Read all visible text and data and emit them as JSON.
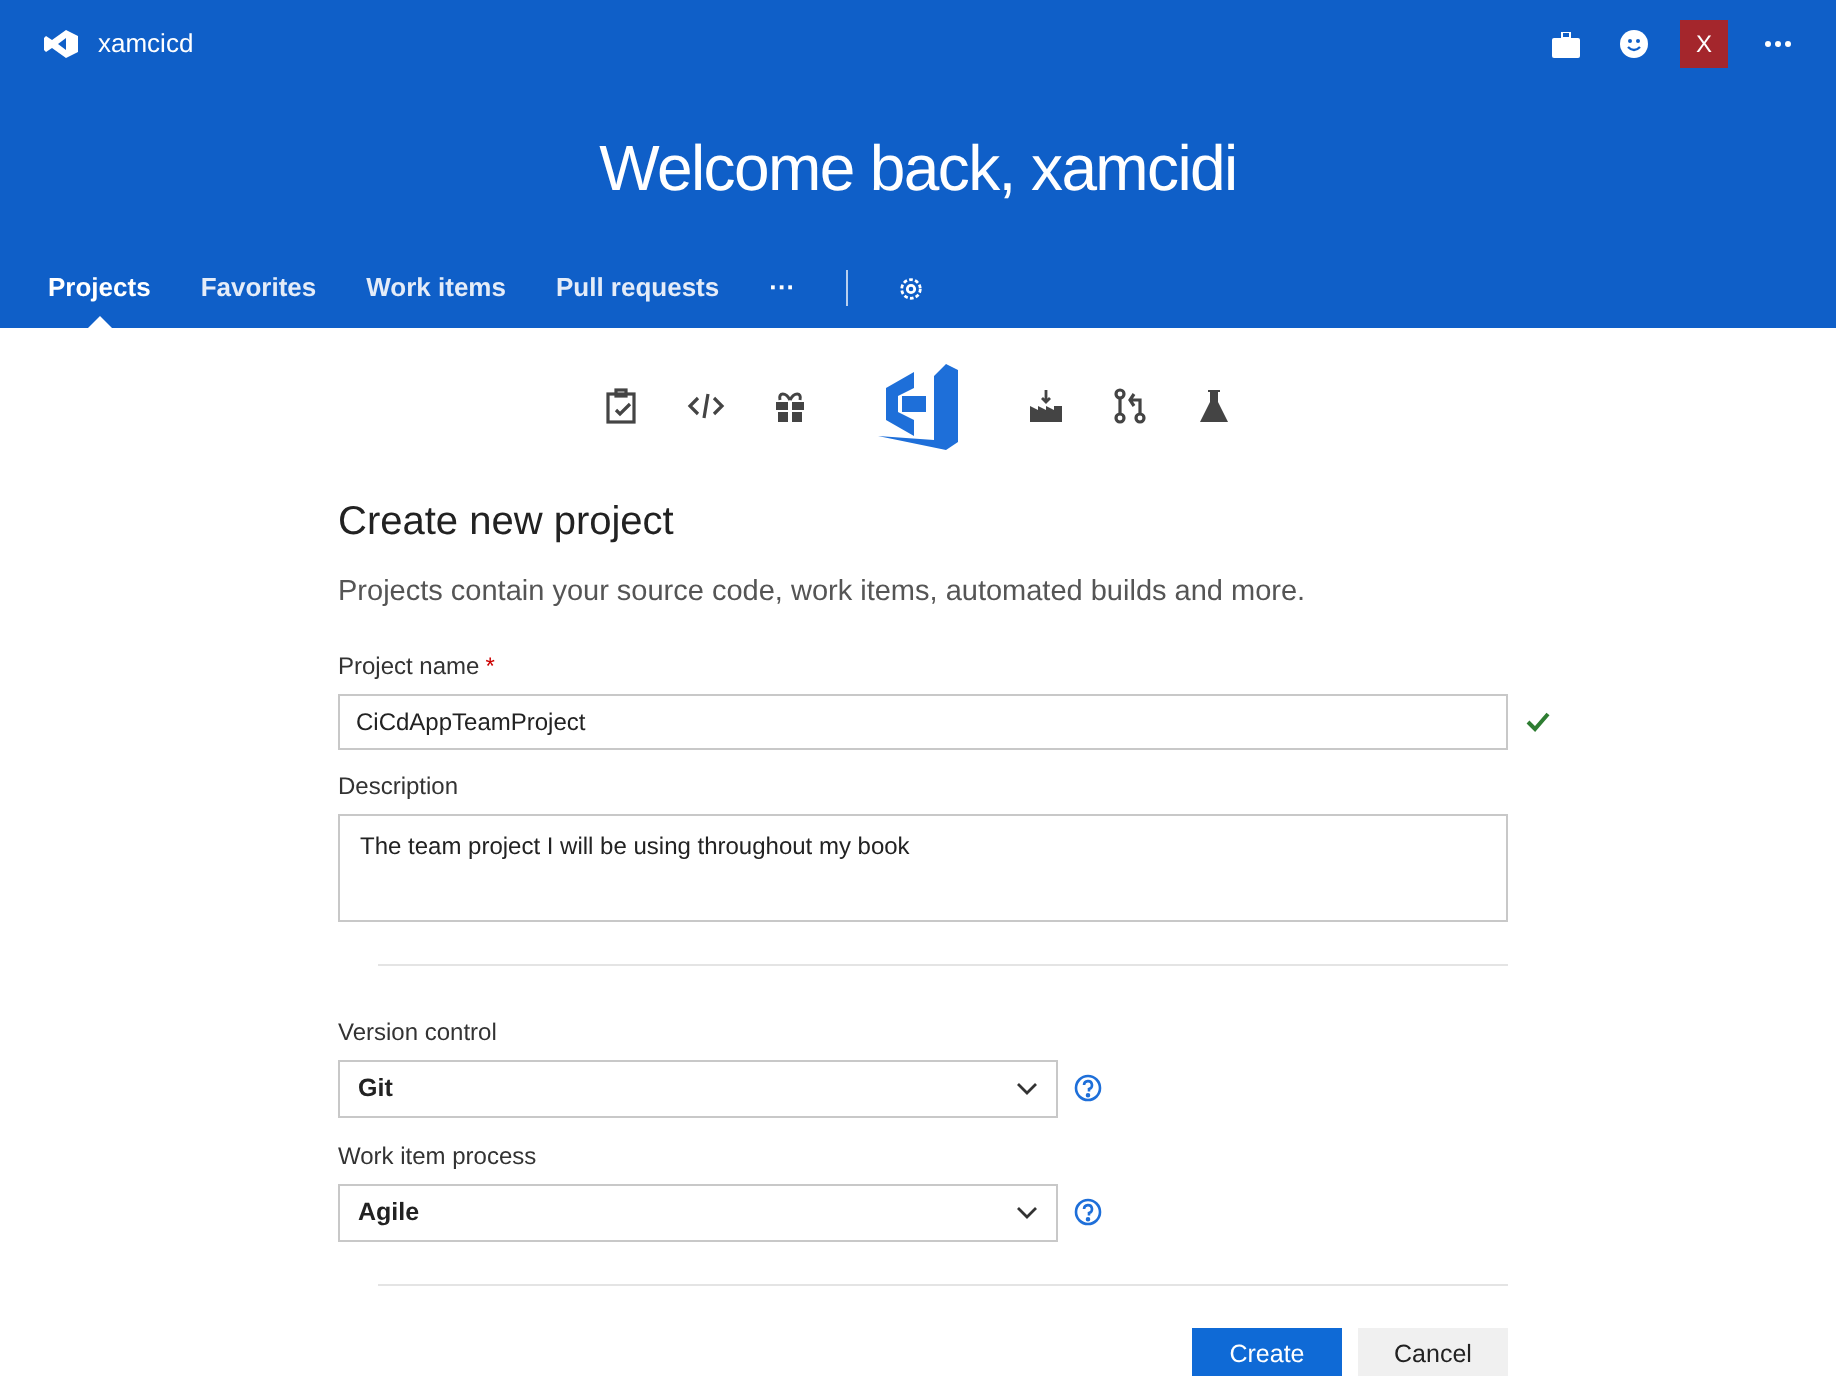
{
  "header": {
    "account": "xamcicd",
    "avatar": "X",
    "title": "Welcome back, xamcidi"
  },
  "nav": [
    {
      "label": "Projects",
      "selected": true
    },
    {
      "label": "Favorites",
      "selected": false
    },
    {
      "label": "Work items",
      "selected": false
    },
    {
      "label": "Pull requests",
      "selected": false
    }
  ],
  "nav_more": "···",
  "form": {
    "title": "Create new project",
    "subtitle": "Projects contain your source code, work items, automated builds and more.",
    "name_label": "Project name",
    "required_mark": "*",
    "name_value": "CiCdAppTeamProject",
    "name_valid": true,
    "description_label": "Description",
    "description_value": "The team project I will be using throughout my book",
    "selects": [
      {
        "label": "Version control",
        "value": "Git"
      },
      {
        "label": "Work item process",
        "value": "Agile"
      }
    ],
    "buttons": [
      {
        "label": "Create",
        "kind": "primary"
      },
      {
        "label": "Cancel",
        "kind": "secondary"
      }
    ]
  }
}
